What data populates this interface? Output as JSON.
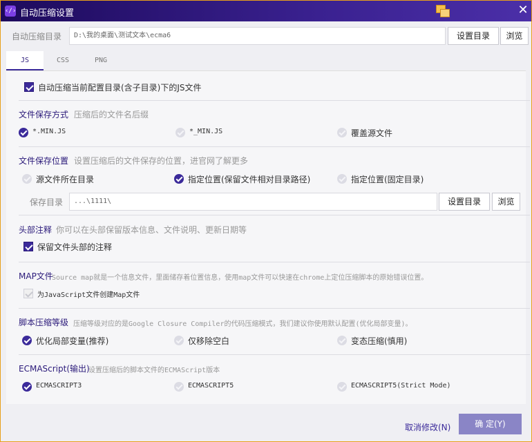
{
  "window": {
    "title": "自动压缩设置",
    "app_icon_text": "‹/›"
  },
  "dir": {
    "label": "自动压缩目录",
    "value": "D:\\我的桌面\\测试文本\\ecma6",
    "set_dir_label": "设置目录",
    "browse_label": "浏览"
  },
  "tabs": [
    {
      "label": "JS"
    },
    {
      "label": "CSS"
    },
    {
      "label": "PNG"
    }
  ],
  "auto_compress": {
    "label": "自动压缩当前配置目录(含子目录)下的JS文件"
  },
  "save_mode": {
    "title": "文件保存方式",
    "desc": "压缩后的文件名后缀",
    "options": [
      {
        "label": "*.MIN.JS"
      },
      {
        "label": "*_MIN.JS"
      },
      {
        "label": "覆盖源文件"
      }
    ]
  },
  "save_location": {
    "title": "文件保存位置",
    "desc": "设置压缩后的文件保存的位置，进官网了解更多",
    "options": [
      {
        "label": "源文件所在目录"
      },
      {
        "label": "指定位置(保留文件相对目录路径)"
      },
      {
        "label": "指定位置(固定目录)"
      }
    ],
    "save_dir_label": "保存目录",
    "save_dir_value": "...\\1111\\",
    "set_dir_label": "设置目录",
    "browse_label": "浏览"
  },
  "header_comment": {
    "title": "头部注释",
    "desc": "你可以在头部保留版本信息、文件说明、更新日期等",
    "option": "保留文件头部的注释"
  },
  "map_file": {
    "title": "MAP文件",
    "desc": "Source map就是一个信息文件，里面储存着位置信息，使用map文件可以快速在chrome上定位压缩脚本的原始错误位置。",
    "option": "为JavaScript文件创建Map文件"
  },
  "compress_level": {
    "title": "脚本压缩等级",
    "desc": "压缩等级对应的是Google Closure Compiler的代码压缩模式，我们建议你使用默认配置(优化局部变量)。",
    "options": [
      {
        "label": "优化局部变量(推荐)"
      },
      {
        "label": "仅移除空白"
      },
      {
        "label": "变态压缩(慎用)"
      }
    ]
  },
  "ecmascript": {
    "title": "ECMAScript(输出)",
    "desc": "设置压缩后的脚本文件的ECMAScript版本",
    "options": [
      {
        "label": "ECMASCRIPT3"
      },
      {
        "label": "ECMASCRIPT5"
      },
      {
        "label": "ECMASCRIPT5(Strict Mode)"
      }
    ]
  },
  "footer": {
    "cancel_label": "取消修改(N)",
    "ok_label": "确 定(Y)"
  },
  "colors": {
    "accent": "#3b2a9a",
    "title_bar": "#1d0a5c",
    "ok_button": "#8a85c6"
  }
}
